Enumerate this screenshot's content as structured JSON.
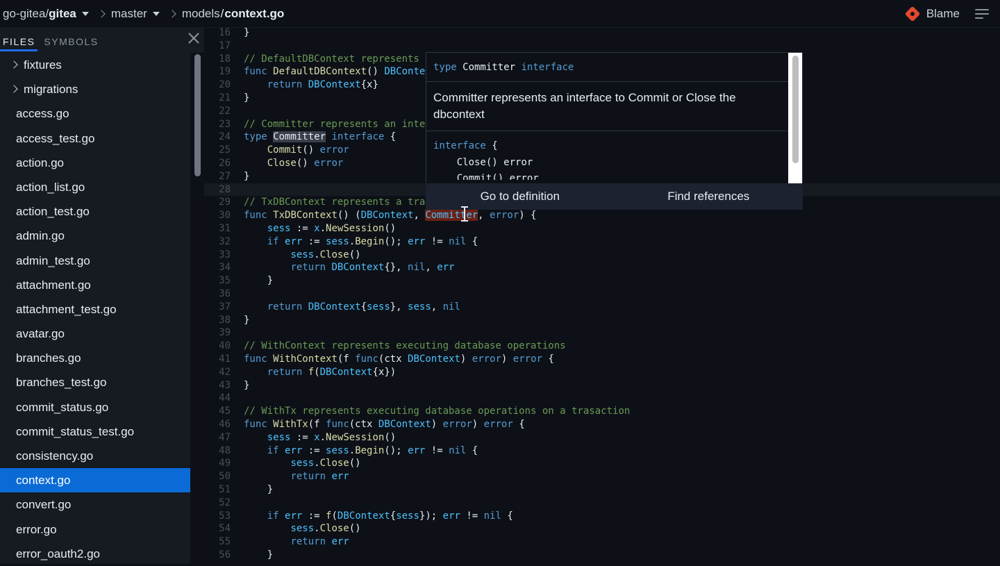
{
  "breadcrumb": {
    "owner": "go-gitea/",
    "repo": "gitea",
    "branch": "master",
    "dir": "models",
    "slash": "/",
    "file": "context.go"
  },
  "toolbar": {
    "blame_label": "Blame",
    "blame_icon": "git-icon",
    "menu_icon": "menu-icon"
  },
  "sidebar": {
    "tabs": [
      {
        "label": "FILES",
        "active": true
      },
      {
        "label": "SYMBOLS",
        "active": false
      }
    ],
    "close_icon": "close-icon",
    "items": [
      {
        "label": "fixtures",
        "folder": true
      },
      {
        "label": "migrations",
        "folder": true
      },
      {
        "label": "access.go"
      },
      {
        "label": "access_test.go"
      },
      {
        "label": "action.go"
      },
      {
        "label": "action_list.go"
      },
      {
        "label": "action_test.go"
      },
      {
        "label": "admin.go"
      },
      {
        "label": "admin_test.go"
      },
      {
        "label": "attachment.go"
      },
      {
        "label": "attachment_test.go"
      },
      {
        "label": "avatar.go"
      },
      {
        "label": "branches.go"
      },
      {
        "label": "branches_test.go"
      },
      {
        "label": "commit_status.go"
      },
      {
        "label": "commit_status_test.go"
      },
      {
        "label": "consistency.go"
      },
      {
        "label": "context.go",
        "selected": true
      },
      {
        "label": "convert.go"
      },
      {
        "label": "error.go"
      },
      {
        "label": "error_oauth2.go"
      }
    ],
    "selected_color": "#0b6bd6"
  },
  "editor": {
    "current_line": 28,
    "lines": [
      {
        "n": "16",
        "tokens": [
          [
            "p",
            "}"
          ]
        ]
      },
      {
        "n": "17",
        "tokens": []
      },
      {
        "n": "18",
        "tokens": [
          [
            "c",
            "// DefaultDBContext represents"
          ]
        ]
      },
      {
        "n": "19",
        "tokens": [
          [
            "k",
            "func "
          ],
          [
            "f",
            "DefaultDBContext"
          ],
          [
            "p",
            "() "
          ],
          [
            "t",
            "DBConte"
          ]
        ]
      },
      {
        "n": "20",
        "tokens": [
          [
            "p",
            "    "
          ],
          [
            "k",
            "return "
          ],
          [
            "t",
            "DBContext"
          ],
          [
            "p",
            "{x}"
          ]
        ]
      },
      {
        "n": "21",
        "tokens": [
          [
            "p",
            "}"
          ]
        ]
      },
      {
        "n": "22",
        "tokens": []
      },
      {
        "n": "23",
        "tokens": [
          [
            "c",
            "// Committer represents an inte"
          ]
        ]
      },
      {
        "n": "24",
        "tokens": [
          [
            "k",
            "type "
          ],
          [
            "r",
            "Committer"
          ],
          [
            "p",
            " "
          ],
          [
            "k",
            "interface"
          ],
          [
            "p",
            " {"
          ]
        ]
      },
      {
        "n": "25",
        "tokens": [
          [
            "p",
            "    "
          ],
          [
            "f",
            "Commit"
          ],
          [
            "p",
            "() "
          ],
          [
            "k",
            "error"
          ]
        ]
      },
      {
        "n": "26",
        "tokens": [
          [
            "p",
            "    "
          ],
          [
            "f",
            "Close"
          ],
          [
            "p",
            "() "
          ],
          [
            "k",
            "error"
          ]
        ]
      },
      {
        "n": "27",
        "tokens": [
          [
            "p",
            "}"
          ]
        ]
      },
      {
        "n": "28",
        "tokens": []
      },
      {
        "n": "29",
        "tokens": [
          [
            "c",
            "// TxDBContext represents a tra"
          ]
        ]
      },
      {
        "n": "30",
        "tokens": [
          [
            "k",
            "func "
          ],
          [
            "f",
            "TxDBContext"
          ],
          [
            "p",
            "() ("
          ],
          [
            "t",
            "DBContext"
          ],
          [
            "p",
            ", "
          ],
          [
            "s",
            "Committer"
          ],
          [
            "p",
            ", "
          ],
          [
            "k",
            "error"
          ],
          [
            "p",
            ") {"
          ]
        ]
      },
      {
        "n": "31",
        "tokens": [
          [
            "p",
            "    "
          ],
          [
            "t",
            "sess"
          ],
          [
            "p",
            " := "
          ],
          [
            "t",
            "x"
          ],
          [
            "p",
            "."
          ],
          [
            "f",
            "NewSession"
          ],
          [
            "p",
            "()"
          ]
        ]
      },
      {
        "n": "32",
        "tokens": [
          [
            "p",
            "    "
          ],
          [
            "k",
            "if "
          ],
          [
            "t",
            "err"
          ],
          [
            "p",
            " := "
          ],
          [
            "t",
            "sess"
          ],
          [
            "p",
            "."
          ],
          [
            "f",
            "Begin"
          ],
          [
            "p",
            "(); "
          ],
          [
            "t",
            "err"
          ],
          [
            "p",
            " != "
          ],
          [
            "k",
            "nil"
          ],
          [
            "p",
            " {"
          ]
        ]
      },
      {
        "n": "33",
        "tokens": [
          [
            "p",
            "        "
          ],
          [
            "t",
            "sess"
          ],
          [
            "p",
            "."
          ],
          [
            "f",
            "Close"
          ],
          [
            "p",
            "()"
          ]
        ]
      },
      {
        "n": "34",
        "tokens": [
          [
            "p",
            "        "
          ],
          [
            "k",
            "return "
          ],
          [
            "t",
            "DBContext"
          ],
          [
            "p",
            "{}, "
          ],
          [
            "k",
            "nil"
          ],
          [
            "p",
            ", "
          ],
          [
            "t",
            "err"
          ]
        ]
      },
      {
        "n": "35",
        "tokens": [
          [
            "p",
            "    }"
          ]
        ]
      },
      {
        "n": "36",
        "tokens": []
      },
      {
        "n": "37",
        "tokens": [
          [
            "p",
            "    "
          ],
          [
            "k",
            "return "
          ],
          [
            "t",
            "DBContext"
          ],
          [
            "p",
            "{"
          ],
          [
            "t",
            "sess"
          ],
          [
            "p",
            "}, "
          ],
          [
            "t",
            "sess"
          ],
          [
            "p",
            ", "
          ],
          [
            "k",
            "nil"
          ]
        ]
      },
      {
        "n": "38",
        "tokens": [
          [
            "p",
            "}"
          ]
        ]
      },
      {
        "n": "39",
        "tokens": []
      },
      {
        "n": "40",
        "tokens": [
          [
            "c",
            "// WithContext represents executing database operations"
          ]
        ]
      },
      {
        "n": "41",
        "tokens": [
          [
            "k",
            "func "
          ],
          [
            "f",
            "WithContext"
          ],
          [
            "p",
            "(f "
          ],
          [
            "k",
            "func"
          ],
          [
            "p",
            "(ctx "
          ],
          [
            "t",
            "DBContext"
          ],
          [
            "p",
            ") "
          ],
          [
            "k",
            "error"
          ],
          [
            "p",
            ") "
          ],
          [
            "k",
            "error"
          ],
          [
            "p",
            " {"
          ]
        ]
      },
      {
        "n": "42",
        "tokens": [
          [
            "p",
            "    "
          ],
          [
            "k",
            "return "
          ],
          [
            "f",
            "f"
          ],
          [
            "p",
            "("
          ],
          [
            "t",
            "DBContext"
          ],
          [
            "p",
            "{x})"
          ]
        ]
      },
      {
        "n": "43",
        "tokens": [
          [
            "p",
            "}"
          ]
        ]
      },
      {
        "n": "44",
        "tokens": []
      },
      {
        "n": "45",
        "tokens": [
          [
            "c",
            "// WithTx represents executing database operations on a trasaction"
          ]
        ]
      },
      {
        "n": "46",
        "tokens": [
          [
            "k",
            "func "
          ],
          [
            "f",
            "WithTx"
          ],
          [
            "p",
            "(f "
          ],
          [
            "k",
            "func"
          ],
          [
            "p",
            "(ctx "
          ],
          [
            "t",
            "DBContext"
          ],
          [
            "p",
            ") "
          ],
          [
            "k",
            "error"
          ],
          [
            "p",
            ") "
          ],
          [
            "k",
            "error"
          ],
          [
            "p",
            " {"
          ]
        ]
      },
      {
        "n": "47",
        "tokens": [
          [
            "p",
            "    "
          ],
          [
            "t",
            "sess"
          ],
          [
            "p",
            " := "
          ],
          [
            "t",
            "x"
          ],
          [
            "p",
            "."
          ],
          [
            "f",
            "NewSession"
          ],
          [
            "p",
            "()"
          ]
        ]
      },
      {
        "n": "48",
        "tokens": [
          [
            "p",
            "    "
          ],
          [
            "k",
            "if "
          ],
          [
            "t",
            "err"
          ],
          [
            "p",
            " := "
          ],
          [
            "t",
            "sess"
          ],
          [
            "p",
            "."
          ],
          [
            "f",
            "Begin"
          ],
          [
            "p",
            "(); "
          ],
          [
            "t",
            "err"
          ],
          [
            "p",
            " != "
          ],
          [
            "k",
            "nil"
          ],
          [
            "p",
            " {"
          ]
        ]
      },
      {
        "n": "49",
        "tokens": [
          [
            "p",
            "        "
          ],
          [
            "t",
            "sess"
          ],
          [
            "p",
            "."
          ],
          [
            "f",
            "Close"
          ],
          [
            "p",
            "()"
          ]
        ]
      },
      {
        "n": "50",
        "tokens": [
          [
            "p",
            "        "
          ],
          [
            "k",
            "return "
          ],
          [
            "t",
            "err"
          ]
        ]
      },
      {
        "n": "51",
        "tokens": [
          [
            "p",
            "    }"
          ]
        ]
      },
      {
        "n": "52",
        "tokens": []
      },
      {
        "n": "53",
        "tokens": [
          [
            "p",
            "    "
          ],
          [
            "k",
            "if "
          ],
          [
            "t",
            "err"
          ],
          [
            "p",
            " := "
          ],
          [
            "f",
            "f"
          ],
          [
            "p",
            "("
          ],
          [
            "t",
            "DBContext"
          ],
          [
            "p",
            "{"
          ],
          [
            "t",
            "sess"
          ],
          [
            "p",
            "}); "
          ],
          [
            "t",
            "err"
          ],
          [
            "p",
            " != "
          ],
          [
            "k",
            "nil"
          ],
          [
            "p",
            " {"
          ]
        ]
      },
      {
        "n": "54",
        "tokens": [
          [
            "p",
            "        "
          ],
          [
            "t",
            "sess"
          ],
          [
            "p",
            "."
          ],
          [
            "f",
            "Close"
          ],
          [
            "p",
            "()"
          ]
        ]
      },
      {
        "n": "55",
        "tokens": [
          [
            "p",
            "        "
          ],
          [
            "k",
            "return "
          ],
          [
            "t",
            "err"
          ]
        ]
      },
      {
        "n": "56",
        "tokens": [
          [
            "p",
            "    }"
          ]
        ]
      }
    ]
  },
  "hover": {
    "signature_kw": "type",
    "signature_name": " Committer ",
    "signature_kind": "interface",
    "doc": "Committer represents an interface to Commit or Close the dbcontext",
    "code_line1_kw": "interface",
    "code_line1_rest": " {",
    "code_line2": "    Close() error",
    "code_line3": "    Commit() error",
    "go_to_definition": "Go to definition",
    "find_references": "Find references"
  }
}
